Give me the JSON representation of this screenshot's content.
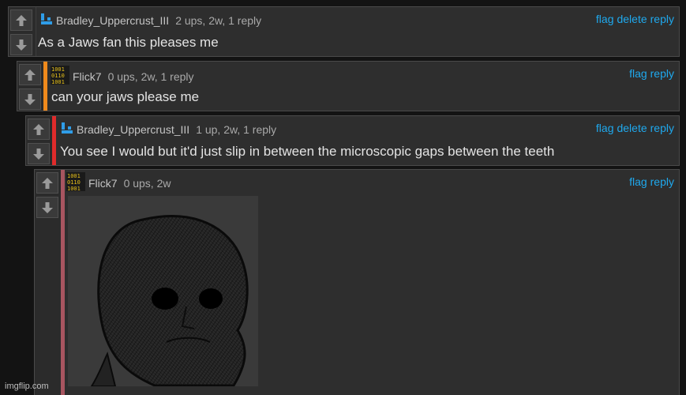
{
  "comments": [
    {
      "username": "Bradley_Uppercrust_III",
      "meta": "2 ups, 2w, 1 reply",
      "text": "As a Jaws fan this pleases me",
      "actions": [
        "flag",
        "delete",
        "reply"
      ],
      "avatar": "blue-l-icon",
      "bar_color": ""
    },
    {
      "username": "Flick7",
      "meta": "0 ups, 2w, 1 reply",
      "text": "can your jaws please me",
      "actions": [
        "flag",
        "reply"
      ],
      "avatar": "binary-icon",
      "bar_color": "#f08a1c"
    },
    {
      "username": "Bradley_Uppercrust_III",
      "meta": "1 up, 2w, 1 reply",
      "text": "You see I would but it'd just slip in between the microscopic gaps between the teeth",
      "actions": [
        "flag",
        "delete",
        "reply"
      ],
      "avatar": "blue-l-icon",
      "bar_color": "#e02b2b"
    },
    {
      "username": "Flick7",
      "meta": "0 ups, 2w",
      "text": "",
      "actions": [
        "flag",
        "reply"
      ],
      "avatar": "binary-icon",
      "bar_color": "#a85560",
      "image": "wojak-meme-image"
    }
  ],
  "watermark": "imgflip.com",
  "avatar_binary_lines": [
    "1001",
    "0110",
    "1001"
  ],
  "colors": {
    "link": "#1fa9ee",
    "background": "#131313",
    "panel": "#2e2e2e"
  }
}
